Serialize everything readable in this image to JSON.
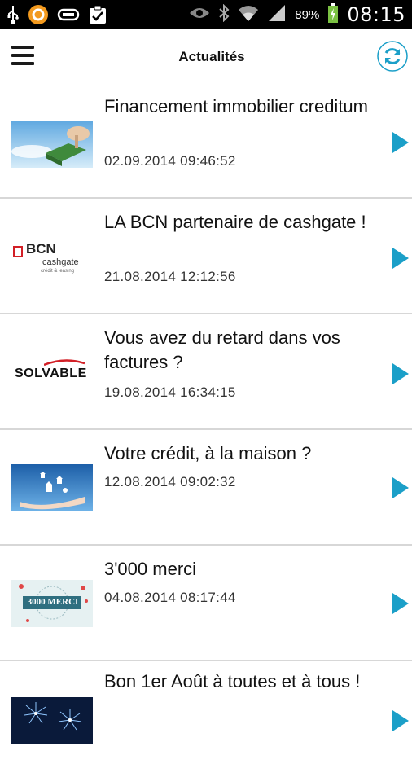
{
  "status_bar": {
    "time": "08:15",
    "battery_percent": "89%",
    "left_icons": [
      "usb-icon",
      "app-notification-icon",
      "sync-icon",
      "task-icon"
    ],
    "right_icons": [
      "eye-icon",
      "bluetooth-icon",
      "wifi-icon",
      "signal-icon",
      "battery-charging-icon"
    ]
  },
  "header": {
    "title": "Actualités",
    "menu_icon": "hamburger-menu-icon",
    "refresh_icon": "refresh-icon"
  },
  "news": [
    {
      "title": "Financement immobilier creditum",
      "date": "02.09.2014 09:46:52",
      "thumb": "house-key-thumbnail"
    },
    {
      "title": "LA BCN partenaire de cashgate !",
      "date": "21.08.2014 12:12:56",
      "thumb": "bcn-cashgate-logo",
      "thumb_text_1": "BCN",
      "thumb_text_2": "cashgate",
      "thumb_text_3": "crédit & leasing"
    },
    {
      "title": "Vous avez du retard dans vos factures ?",
      "date": "19.08.2014 16:34:15",
      "thumb": "solvable-logo",
      "thumb_text": "SOLVABLE"
    },
    {
      "title": "Votre crédit, à la maison ?",
      "date": "12.08.2014 09:02:32",
      "thumb": "hand-houses-thumbnail"
    },
    {
      "title": "3'000 merci",
      "date": "04.08.2014 08:17:44",
      "thumb": "3000-merci-thumbnail",
      "thumb_text": "3000 MERCI"
    },
    {
      "title": "Bon 1er Août à toutes et à tous !",
      "date": "",
      "thumb": "fireworks-thumbnail"
    }
  ],
  "colors": {
    "accent": "#1b9fc8",
    "divider": "#d7d7d7",
    "status_bar": "#000000",
    "battery": "#7bc143"
  }
}
